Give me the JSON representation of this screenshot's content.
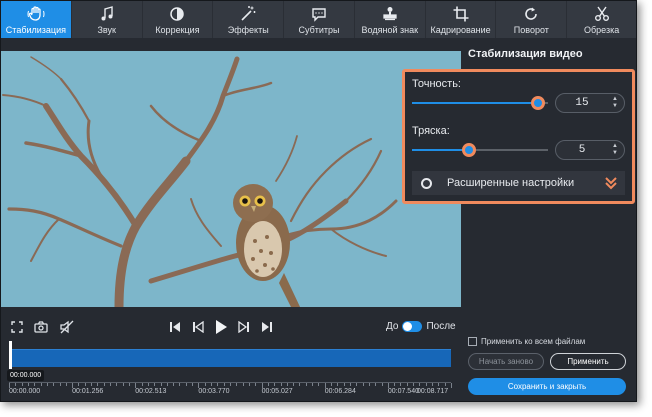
{
  "toolbar": {
    "items": [
      {
        "label": "Стабилизация",
        "icon": "hand-icon"
      },
      {
        "label": "Звук",
        "icon": "music-note-icon"
      },
      {
        "label": "Коррекция",
        "icon": "contrast-icon"
      },
      {
        "label": "Эффекты",
        "icon": "magic-wand-icon"
      },
      {
        "label": "Субтитры",
        "icon": "speech-bubble-icon"
      },
      {
        "label": "Водяной знак",
        "icon": "stamp-icon"
      },
      {
        "label": "Кадрирование",
        "icon": "crop-icon"
      },
      {
        "label": "Поворот",
        "icon": "rotate-icon"
      },
      {
        "label": "Обрезка",
        "icon": "scissors-icon"
      }
    ],
    "active_index": 0,
    "accent_color": "#1f8ee6"
  },
  "panel": {
    "title": "Стабилизация видео",
    "precision": {
      "label": "Точность:",
      "value": "15",
      "slider_fraction": 0.93
    },
    "shake": {
      "label": "Тряска:",
      "value": "5",
      "slider_fraction": 0.42
    },
    "advanced_label": "Расширенные настройки",
    "highlight_color": "#f08a5d"
  },
  "player": {
    "before_label": "До",
    "after_label": "После",
    "current_time": "00:00.000"
  },
  "timeline": {
    "tick_labels": [
      "00:00.000",
      "00:01.256",
      "00:02.513",
      "00:03.770",
      "00:05.027",
      "00:06.284",
      "00:07.540",
      "00:08.717"
    ]
  },
  "footer": {
    "apply_all_label": "Применить ко всем файлам",
    "restart_label": "Начать заново",
    "apply_label": "Применить",
    "save_close_label": "Сохранить и закрыть"
  }
}
